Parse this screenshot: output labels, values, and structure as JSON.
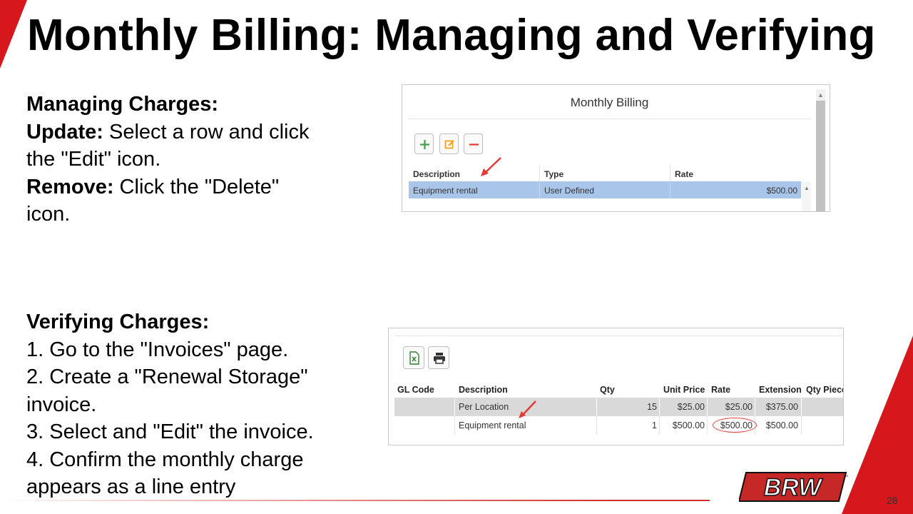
{
  "slide": {
    "title": "Monthly Billing: Managing and Verifying",
    "page_number": "28",
    "logo_text": "BRW",
    "accent_color": "#d6171c"
  },
  "managing": {
    "heading": "Managing Charges:",
    "update_label": "Update:",
    "update_text": " Select a row and click the \"Edit\" icon.",
    "remove_label": "Remove:",
    "remove_text": " Click the \"Delete\" icon."
  },
  "verifying": {
    "heading": "Verifying Charges:",
    "steps": [
      "1. Go to the \"Invoices\" page.",
      "2. Create a \"Renewal Storage\" invoice.",
      "3. Select and \"Edit\" the invoice.",
      "4. Confirm the monthly charge appears as a line entry"
    ]
  },
  "monthly_billing_panel": {
    "title": "Monthly Billing",
    "toolbar": {
      "add_icon": "plus-icon",
      "edit_icon": "edit-icon",
      "delete_icon": "minus-icon"
    },
    "columns": [
      "Description",
      "Type",
      "Rate"
    ],
    "rows": [
      {
        "description": "Equipment rental",
        "type": "User Defined",
        "rate": "$500.00"
      }
    ]
  },
  "invoice_panel": {
    "toolbar": {
      "excel_icon": "excel-export-icon",
      "print_icon": "print-icon"
    },
    "columns": [
      "GL Code",
      "Description",
      "Qty",
      "Unit Price",
      "Rate",
      "Extension",
      "Qty Piece"
    ],
    "rows": [
      {
        "gl_code": "",
        "description": "Per Location",
        "qty": "15",
        "unit_price": "$25.00",
        "rate": "$25.00",
        "extension": "$375.00"
      },
      {
        "gl_code": "",
        "description": "Equipment rental",
        "qty": "1",
        "unit_price": "$500.00",
        "rate": "$500.00",
        "extension": "$500.00"
      }
    ]
  }
}
